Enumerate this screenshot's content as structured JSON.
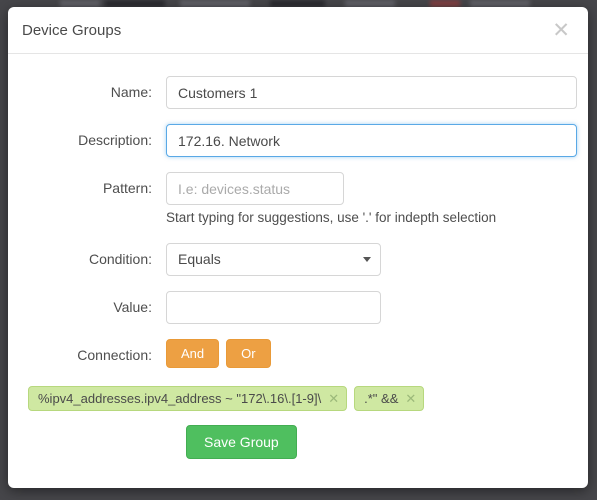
{
  "modal": {
    "title": "Device Groups",
    "close_icon": "close-icon"
  },
  "form": {
    "name": {
      "label": "Name:",
      "value": "Customers 1",
      "placeholder": ""
    },
    "description": {
      "label": "Description:",
      "value_before_caret": "172.16.",
      "value_after_caret": "Network",
      "value": "172.16. Network",
      "placeholder": "",
      "focused": true
    },
    "pattern": {
      "label": "Pattern:",
      "value": "",
      "placeholder": "I.e: devices.status",
      "help": "Start typing for suggestions, use '.' for indepth selection"
    },
    "condition": {
      "label": "Condition:",
      "selected": "Equals",
      "options": [
        "Equals"
      ],
      "arrow_icon": "chevron-down-icon"
    },
    "value": {
      "label": "Value:",
      "value": "",
      "placeholder": ""
    },
    "connection": {
      "label": "Connection:",
      "and_label": "And",
      "or_label": "Or"
    }
  },
  "tags": [
    {
      "text": "%ipv4_addresses.ipv4_address ~ \"172\\.16\\.[1-9]\\",
      "remove_icon": "remove-tag-icon"
    },
    {
      "text": ".*\" &&",
      "remove_icon": "remove-tag-icon"
    }
  ],
  "actions": {
    "save_label": "Save Group"
  },
  "colors": {
    "accent_blue": "#5aa9e6",
    "orange": "#eda043",
    "green": "#4fbf5f",
    "tag_green": "#cfe8a2",
    "backdrop": "#46464a"
  }
}
